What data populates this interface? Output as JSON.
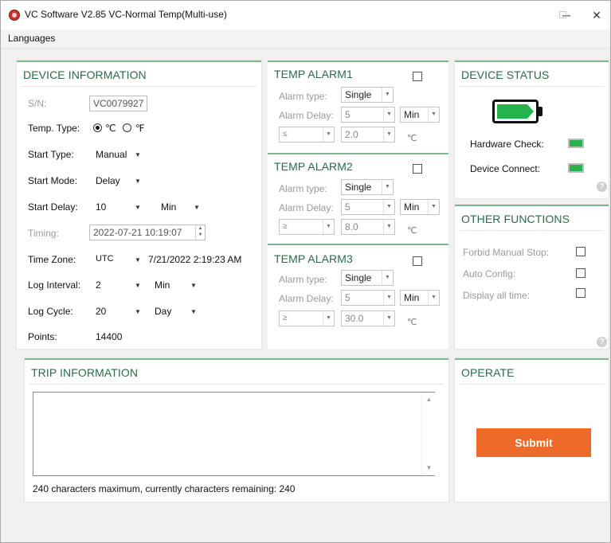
{
  "window": {
    "title": "VC Software V2.85 VC-Normal Temp(Multi-use)",
    "controls": {
      "minimize": "─",
      "close": "✕"
    }
  },
  "menu": {
    "languages": "Languages"
  },
  "device_info": {
    "title": "DEVICE INFORMATION",
    "sn_label": "S/N:",
    "sn_value": "VC0079927",
    "temp_type_label": "Temp. Type:",
    "temp_c": "℃",
    "temp_f": "℉",
    "temp_selected": "C",
    "start_type_label": "Start Type:",
    "start_type_value": "Manual",
    "start_mode_label": "Start Mode:",
    "start_mode_value": "Delay",
    "start_delay_label": "Start Delay:",
    "start_delay_value": "10",
    "start_delay_unit": "Min",
    "timing_label": "Timing:",
    "timing_value": "2022-07-21 10:19:07",
    "time_zone_label": "Time Zone:",
    "time_zone_value": "UTC",
    "time_zone_datetime": "7/21/2022 2:19:23 AM",
    "log_interval_label": "Log Interval:",
    "log_interval_value": "2",
    "log_interval_unit": "Min",
    "log_cycle_label": "Log Cycle:",
    "log_cycle_value": "20",
    "log_cycle_unit": "Day",
    "points_label": "Points:",
    "points_value": "14400"
  },
  "alarms": [
    {
      "title": "TEMP ALARM1",
      "type_label": "Alarm type:",
      "type_value": "Single",
      "delay_label": "Alarm Delay:",
      "delay_value": "5",
      "delay_unit": "Min",
      "op": "≤",
      "threshold": "2.0",
      "unit": "℃"
    },
    {
      "title": "TEMP ALARM2",
      "type_label": "Alarm type:",
      "type_value": "Single",
      "delay_label": "Alarm Delay:",
      "delay_value": "5",
      "delay_unit": "Min",
      "op": "≥",
      "threshold": "8.0",
      "unit": "℃"
    },
    {
      "title": "TEMP ALARM3",
      "type_label": "Alarm type:",
      "type_value": "Single",
      "delay_label": "Alarm Delay:",
      "delay_value": "5",
      "delay_unit": "Min",
      "op": "≥",
      "threshold": "30.0",
      "unit": "℃"
    }
  ],
  "device_status": {
    "title": "DEVICE STATUS",
    "hardware_check_label": "Hardware Check:",
    "device_connect_label": "Device Connect:",
    "help": "?"
  },
  "other_functions": {
    "title": "OTHER FUNCTIONS",
    "forbid_manual_stop": "Forbid Manual Stop:",
    "auto_config": "Auto Config:",
    "display_all_time": "Display all time:",
    "help": "?"
  },
  "trip_info": {
    "title": "TRIP INFORMATION",
    "text": "",
    "counter": "240 characters maximum, currently characters remaining: 240"
  },
  "operate": {
    "title": "OPERATE",
    "submit_label": "Submit"
  },
  "glyphs": {
    "dd": "▼",
    "up": "▲",
    "down": "▼"
  },
  "colors": {
    "accent_green": "#2a6a4a",
    "panel_line": "#7fb495",
    "submit": "#ed6a2a",
    "led": "#27b24a"
  }
}
